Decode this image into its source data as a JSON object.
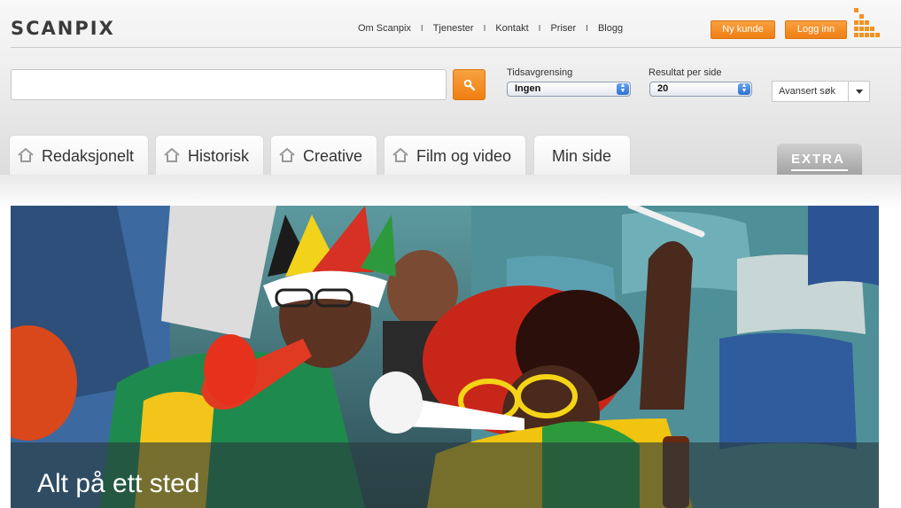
{
  "brand": {
    "name": "SCANPIX",
    "accent": "#f29222"
  },
  "topnav": {
    "links": [
      "Om Scanpix",
      "Tjenester",
      "Kontakt",
      "Priser",
      "Blogg"
    ],
    "separator": "I"
  },
  "account": {
    "new_customer": "Ny kunde",
    "login": "Logg inn"
  },
  "search": {
    "value": "",
    "button_icon": "search-icon",
    "time_filter_label": "Tidsavgrensing",
    "time_filter_value": "Ingen",
    "per_page_label": "Resultat per side",
    "per_page_value": "20",
    "advanced_label": "Avansert søk"
  },
  "tabs": [
    "Redaksjonelt",
    "Historisk",
    "Creative",
    "Film og video",
    "Min side"
  ],
  "extra_tab": "EXTRA",
  "hero": {
    "caption": "Alt på ett sted"
  }
}
